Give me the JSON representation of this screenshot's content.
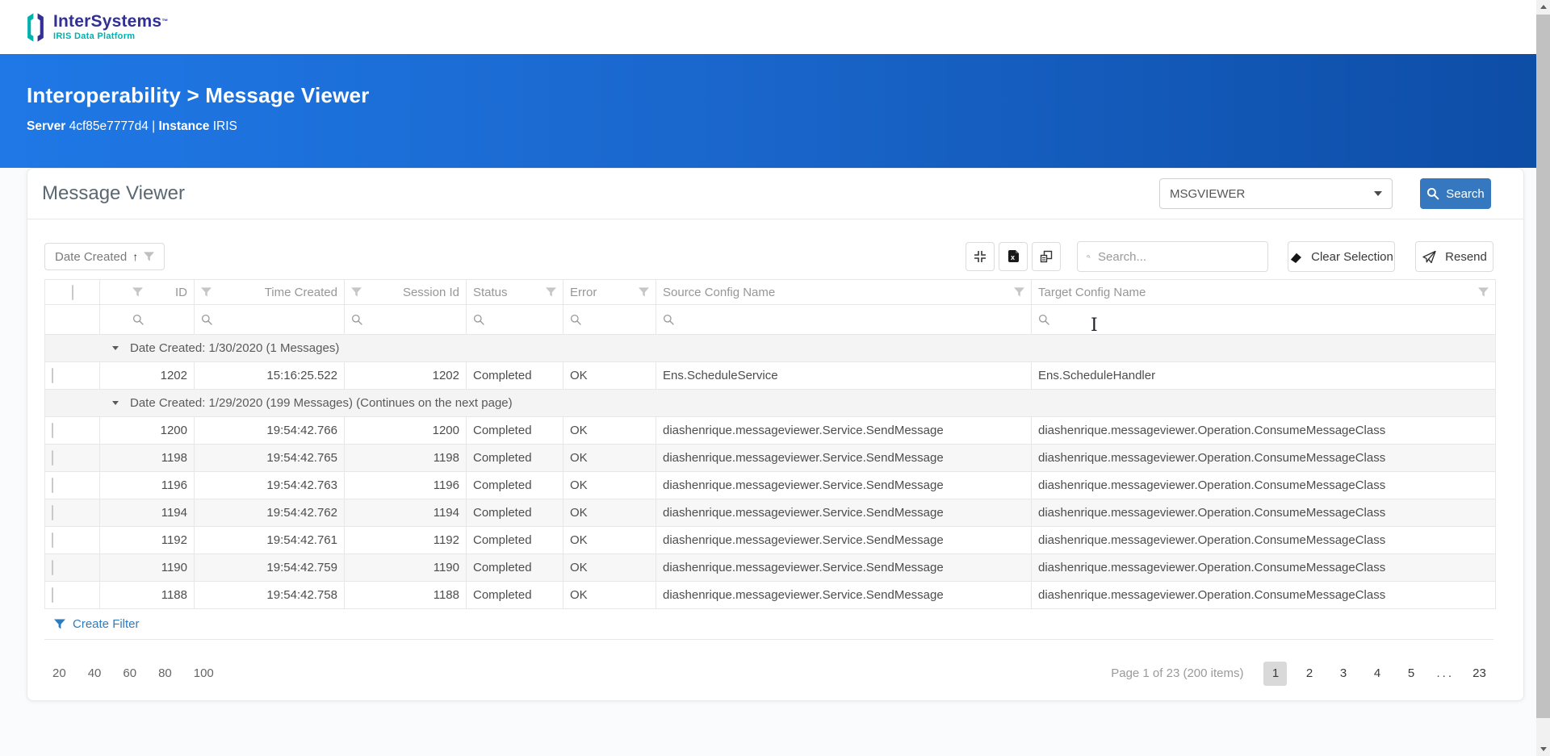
{
  "colors": {
    "banner_gradient_from": "#1f78e6",
    "banner_gradient_to": "#0d4da6",
    "primary_button_blue": "#3578bf",
    "link_blue": "#2d7bbf",
    "brand_navy": "#322f95",
    "brand_teal": "#00b2ad",
    "active_page_bg": "#d9d9d9",
    "group_row_bg": "#f4f4f4",
    "alt_row_bg": "#f7f7f7"
  },
  "icons": {
    "logo_mark": "intersystems-logo-icon",
    "collapse": "collapse-icon",
    "export_excel": "export-excel-icon",
    "column_chooser": "column-chooser-icon",
    "search": "search-icon",
    "filter": "filter-funnel-icon",
    "eraser": "eraser-icon",
    "send": "paper-plane-icon",
    "caret": "caret-down-icon",
    "text_cursor": "i-beam-cursor"
  },
  "topbar": {
    "brand": "InterSystems",
    "trademark": "™",
    "product": "IRIS Data Platform"
  },
  "banner": {
    "breadcrumb": "Interoperability > Message Viewer",
    "server_label": "Server",
    "server_value": "4cf85e7777d4",
    "separator": "|",
    "instance_label": "Instance",
    "instance_value": "IRIS"
  },
  "panel": {
    "title": "Message Viewer",
    "namespace_value": "MSGVIEWER",
    "search_label": "Search"
  },
  "toolbar": {
    "sort_field": "Date Created",
    "sort_direction": "↑",
    "search_placeholder": "Search...",
    "clear_selection_label": "Clear Selection",
    "resend_label": "Resend"
  },
  "table": {
    "headers": [
      {
        "label": "ID",
        "align": "right"
      },
      {
        "label": "Time Created",
        "align": "right"
      },
      {
        "label": "Session Id",
        "align": "right"
      },
      {
        "label": "Status",
        "align": "left"
      },
      {
        "label": "Error",
        "align": "left"
      },
      {
        "label": "Source Config Name",
        "align": "left"
      },
      {
        "label": "Target Config Name",
        "align": "left"
      }
    ],
    "groups": [
      {
        "label": "Date Created: 1/30/2020 (1 Messages)",
        "rows": [
          {
            "id": "1202",
            "time": "15:16:25.522",
            "session": "1202",
            "status": "Completed",
            "error": "OK",
            "source": "Ens.ScheduleService",
            "target": "Ens.ScheduleHandler"
          }
        ]
      },
      {
        "label": "Date Created: 1/29/2020 (199 Messages) (Continues on the next page)",
        "rows": [
          {
            "id": "1200",
            "time": "19:54:42.766",
            "session": "1200",
            "status": "Completed",
            "error": "OK",
            "source": "diashenrique.messageviewer.Service.SendMessage",
            "target": "diashenrique.messageviewer.Operation.ConsumeMessageClass"
          },
          {
            "id": "1198",
            "time": "19:54:42.765",
            "session": "1198",
            "status": "Completed",
            "error": "OK",
            "source": "diashenrique.messageviewer.Service.SendMessage",
            "target": "diashenrique.messageviewer.Operation.ConsumeMessageClass"
          },
          {
            "id": "1196",
            "time": "19:54:42.763",
            "session": "1196",
            "status": "Completed",
            "error": "OK",
            "source": "diashenrique.messageviewer.Service.SendMessage",
            "target": "diashenrique.messageviewer.Operation.ConsumeMessageClass"
          },
          {
            "id": "1194",
            "time": "19:54:42.762",
            "session": "1194",
            "status": "Completed",
            "error": "OK",
            "source": "diashenrique.messageviewer.Service.SendMessage",
            "target": "diashenrique.messageviewer.Operation.ConsumeMessageClass"
          },
          {
            "id": "1192",
            "time": "19:54:42.761",
            "session": "1192",
            "status": "Completed",
            "error": "OK",
            "source": "diashenrique.messageviewer.Service.SendMessage",
            "target": "diashenrique.messageviewer.Operation.ConsumeMessageClass"
          },
          {
            "id": "1190",
            "time": "19:54:42.759",
            "session": "1190",
            "status": "Completed",
            "error": "OK",
            "source": "diashenrique.messageviewer.Service.SendMessage",
            "target": "diashenrique.messageviewer.Operation.ConsumeMessageClass"
          },
          {
            "id": "1188",
            "time": "19:54:42.758",
            "session": "1188",
            "status": "Completed",
            "error": "OK",
            "source": "diashenrique.messageviewer.Service.SendMessage",
            "target": "diashenrique.messageviewer.Operation.ConsumeMessageClass"
          }
        ]
      }
    ]
  },
  "footer": {
    "create_filter_label": "Create Filter",
    "page_sizes": [
      "20",
      "40",
      "60",
      "80",
      "100"
    ],
    "page_status": "Page 1 of 23 (200 items)",
    "pages": [
      "1",
      "2",
      "3",
      "4",
      "5",
      "...",
      "23"
    ],
    "active_page": "1"
  }
}
